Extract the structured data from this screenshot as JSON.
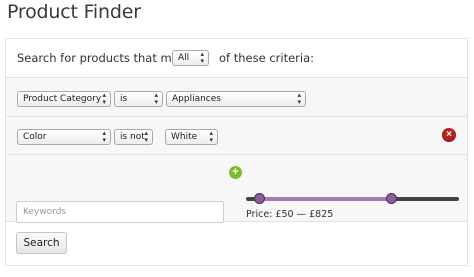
{
  "page": {
    "title": "Product Finder"
  },
  "match": {
    "prefix": "Search for products that match",
    "selected": "All",
    "suffix": "of these criteria:"
  },
  "criteria": [
    {
      "field": "Product Category",
      "operator": "is",
      "value": "Appliances",
      "removable": false
    },
    {
      "field": "Color",
      "operator": "is not",
      "value": "White",
      "removable": true
    }
  ],
  "icons": {
    "remove": "remove-criterion-icon",
    "add": "add-criterion-icon",
    "chevron": "select-chevron-icon"
  },
  "search": {
    "keywords_placeholder": "Keywords",
    "keywords_value": "",
    "button_label": "Search"
  },
  "price": {
    "label": "Price: £50 — £825",
    "min_fraction": 0.06,
    "max_fraction": 0.68
  },
  "colors": {
    "remove": "#b6231f",
    "add": "#7cbb2d",
    "slider_range": "#a678b6",
    "slider_handle": "#8a5d9c",
    "slider_track": "#444444"
  }
}
